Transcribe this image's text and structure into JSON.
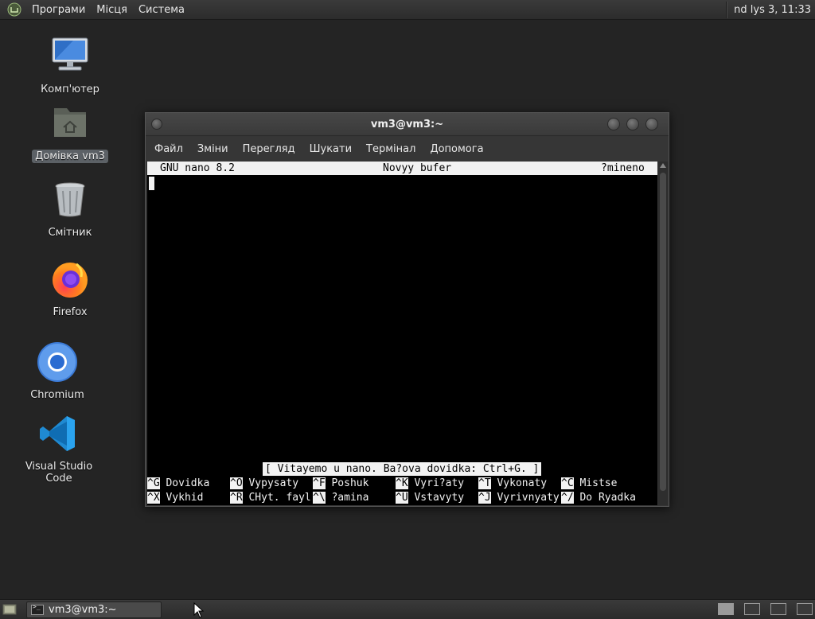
{
  "top_panel": {
    "menus": [
      "Програми",
      "Місця",
      "Система"
    ],
    "clock": "nd lys 3, 11:33"
  },
  "desktop_icons": [
    {
      "label": "Комп'ютер",
      "icon": "computer-icon"
    },
    {
      "label": "Домівка vm3",
      "icon": "home-folder-icon",
      "selected": true
    },
    {
      "label": "Смітник",
      "icon": "trash-icon"
    },
    {
      "label": "Firefox",
      "icon": "firefox-icon"
    },
    {
      "label": "Chromium",
      "icon": "chromium-icon"
    },
    {
      "label": "Visual Studio Code",
      "icon": "vscode-icon"
    }
  ],
  "window": {
    "title": "vm3@vm3:~",
    "menus": [
      "Файл",
      "Зміни",
      "Перегляд",
      "Шукати",
      "Термінал",
      "Допомога"
    ]
  },
  "nano": {
    "version": "GNU nano 8.2",
    "buffer": "Novyy bufer",
    "modified": "?mineno",
    "status_message": "[ Vitayemo u nano. Ba?ova dovidka: Ctrl+G. ]",
    "shortcuts_row1": [
      {
        "key": "^G",
        "label": "Dovidka"
      },
      {
        "key": "^O",
        "label": "Vypysaty"
      },
      {
        "key": "^F",
        "label": "Poshuk"
      },
      {
        "key": "^K",
        "label": "Vyri?aty"
      },
      {
        "key": "^T",
        "label": "Vykonaty"
      },
      {
        "key": "^C",
        "label": "Mistse"
      }
    ],
    "shortcuts_row2": [
      {
        "key": "^X",
        "label": "Vykhid"
      },
      {
        "key": "^R",
        "label": "CHyt. fayl"
      },
      {
        "key": "^\\",
        "label": "?amina"
      },
      {
        "key": "^U",
        "label": "Vstavyty"
      },
      {
        "key": "^J",
        "label": "Vyrivnyaty"
      },
      {
        "key": "^/",
        "label": "Do Ryadka"
      }
    ]
  },
  "taskbar": {
    "task_label": "vm3@vm3:~"
  }
}
